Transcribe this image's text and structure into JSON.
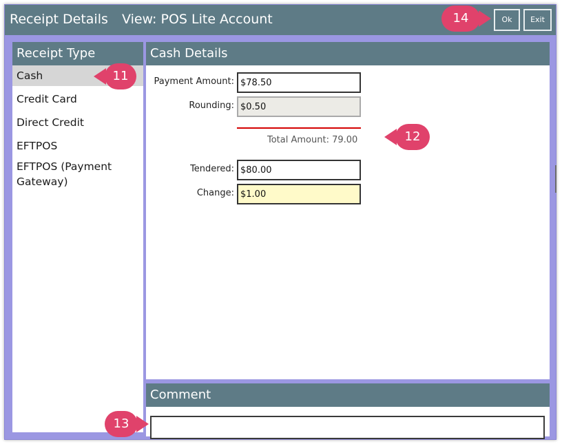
{
  "window": {
    "title": "Receipt Details",
    "view": "View: POS Lite Account",
    "ok_label": "Ok",
    "exit_label": "Exit"
  },
  "receipt_type": {
    "header": "Receipt Type",
    "items": [
      {
        "label": "Cash",
        "selected": true
      },
      {
        "label": "Credit Card",
        "selected": false
      },
      {
        "label": "Direct Credit",
        "selected": false
      },
      {
        "label": "EFTPOS",
        "selected": false
      },
      {
        "label": "EFTPOS (Payment Gateway)",
        "selected": false
      }
    ]
  },
  "cash_details": {
    "header": "Cash Details",
    "payment_amount_label": "Payment Amount:",
    "payment_amount": "$78.50",
    "rounding_label": "Rounding:",
    "rounding": "$0.50",
    "total_amount": "Total Amount: 79.00",
    "tendered_label": "Tendered:",
    "tendered": "$80.00",
    "change_label": "Change:",
    "change": "$1.00"
  },
  "comment": {
    "header": "Comment",
    "value": ""
  },
  "callouts": {
    "c11": "11",
    "c12": "12",
    "c13": "13",
    "c14": "14"
  },
  "colors": {
    "header_bg": "#5e7b86",
    "frame": "#9b97e2",
    "callout": "#e0426b",
    "divider": "#d40000",
    "change_bg": "#fffac9"
  }
}
